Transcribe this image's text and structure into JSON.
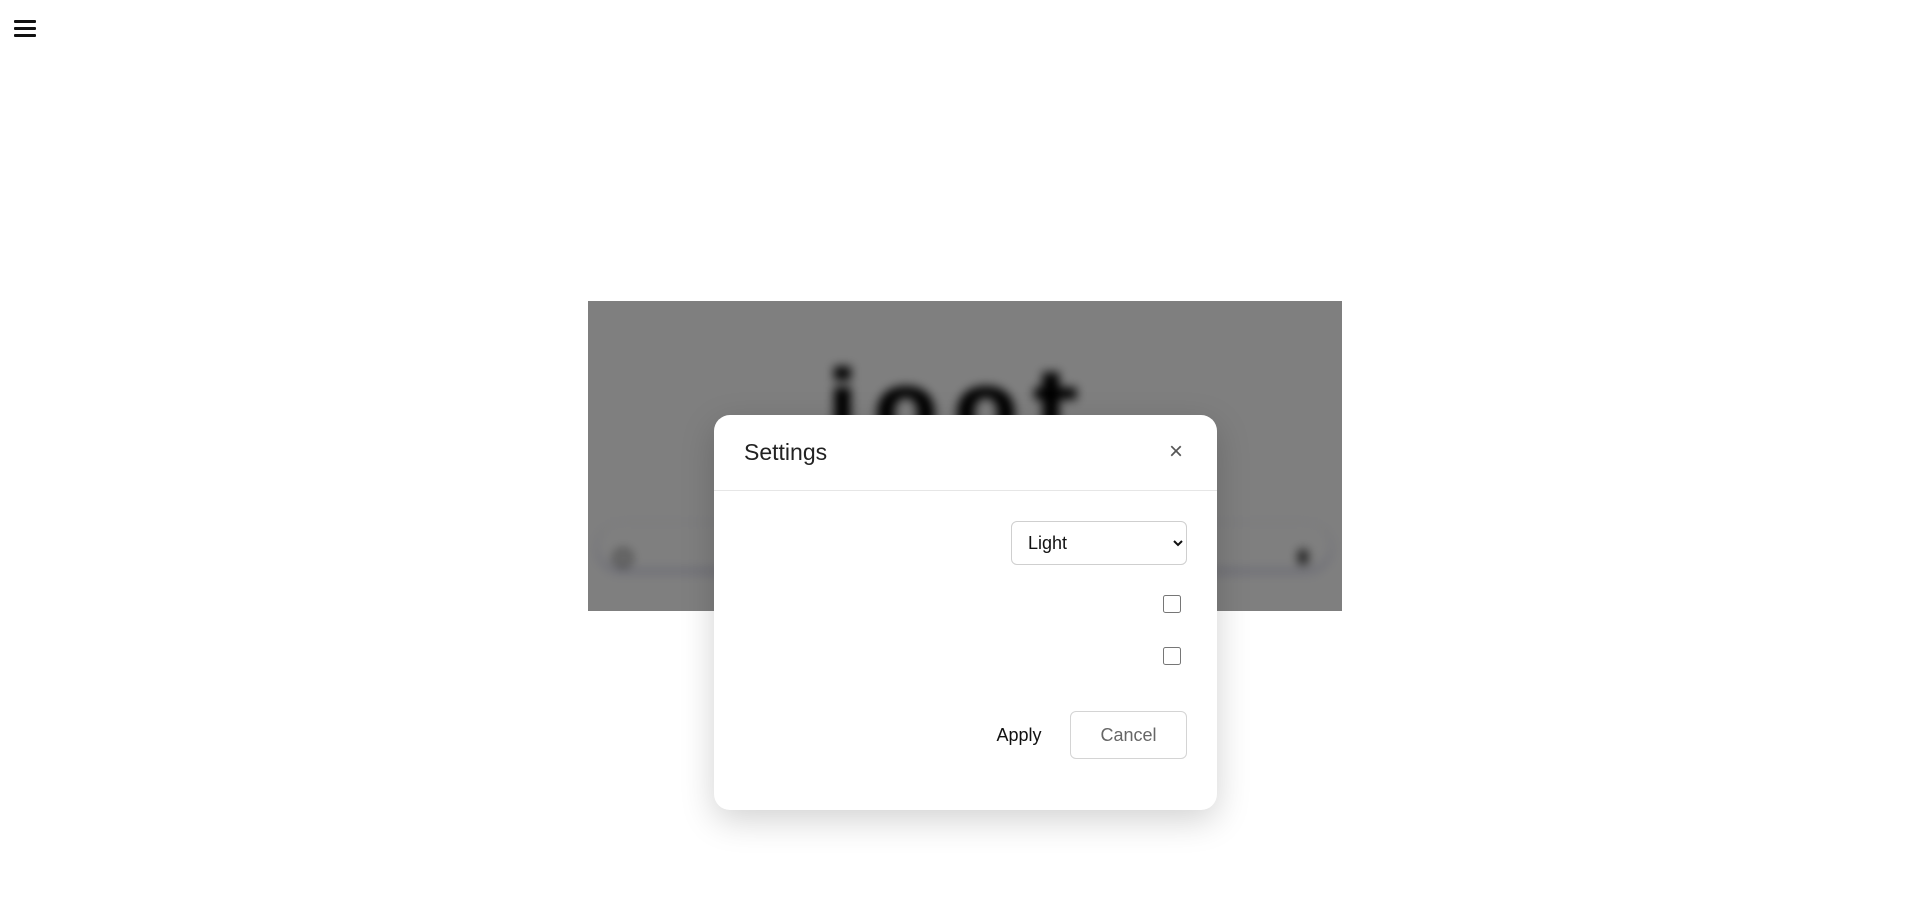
{
  "header": {
    "menu_icon": "hamburger-menu-icon"
  },
  "background": {
    "logo_text": "joot",
    "search_icon": "search-icon",
    "mic_icon": "microphone-icon"
  },
  "settings_modal": {
    "title": "Settings",
    "close_icon": "close-icon",
    "close_label": "×",
    "theme_select": {
      "selected": "Light",
      "options": [
        "Light"
      ]
    },
    "checkboxes": [
      {
        "checked": false
      },
      {
        "checked": false
      }
    ],
    "apply_label": "Apply",
    "cancel_label": "Cancel"
  }
}
